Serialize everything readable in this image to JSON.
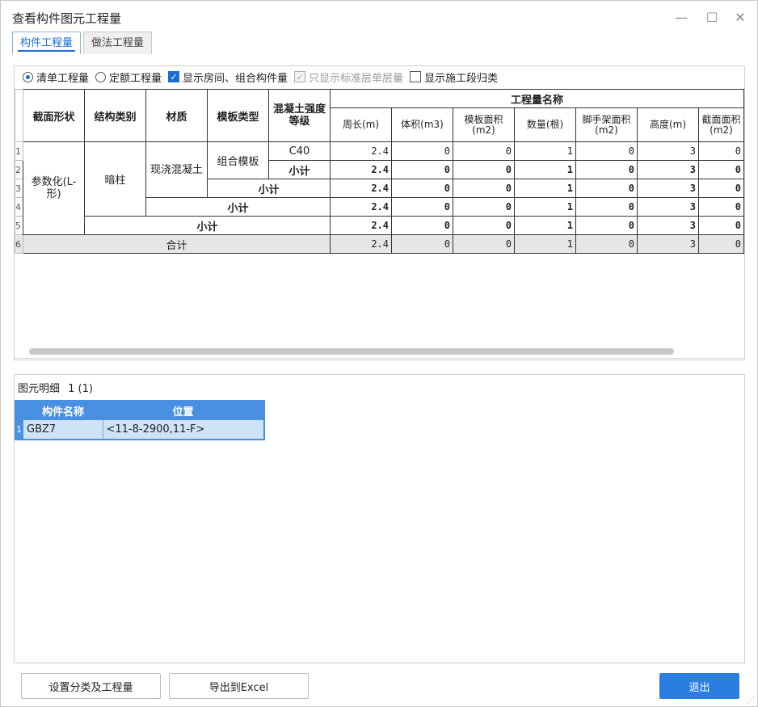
{
  "window": {
    "title": "查看构件图元工程量",
    "minimize_glyph": "—",
    "maximize_glyph": "☐",
    "close_glyph": "✕"
  },
  "tabs": [
    {
      "label": "构件工程量",
      "active": true
    },
    {
      "label": "做法工程量",
      "active": false
    }
  ],
  "options": {
    "qingdan": "清单工程量",
    "dinge": "定额工程量",
    "show_room": "显示房间、组合构件量",
    "std_floor": "只显示标准层单层量",
    "show_stage": "显示施工段归类"
  },
  "table": {
    "headers": {
      "section_shape": "截面形状",
      "struct_type": "结构类别",
      "material": "材质",
      "formwork_type": "模板类型",
      "concrete_grade": "混凝土强度等级",
      "quantity_name": "工程量名称",
      "cols": [
        "周长(m)",
        "体积(m3)",
        "模板面积(m2)",
        "数量(根)",
        "脚手架面积(m2)",
        "高度(m)",
        "截面面积(m2)"
      ]
    },
    "row_numbers": [
      "1",
      "2",
      "3",
      "4",
      "5",
      "6"
    ],
    "cells": {
      "shape": "参数化(L-形)",
      "struct": "暗柱",
      "material": "现浇混凝土",
      "formwork": "组合模板",
      "grade": "C40",
      "subtotal": "小计",
      "total": "合计"
    },
    "rows": [
      [
        "2.4",
        "0",
        "0",
        "1",
        "0",
        "3",
        "0"
      ],
      [
        "2.4",
        "0",
        "0",
        "1",
        "0",
        "3",
        "0"
      ],
      [
        "2.4",
        "0",
        "0",
        "1",
        "0",
        "3",
        "0"
      ],
      [
        "2.4",
        "0",
        "0",
        "1",
        "0",
        "3",
        "0"
      ],
      [
        "2.4",
        "0",
        "0",
        "1",
        "0",
        "3",
        "0"
      ],
      [
        "2.4",
        "0",
        "0",
        "1",
        "0",
        "3",
        "0"
      ]
    ]
  },
  "detail": {
    "title": "图元明细",
    "count": "1 (1)",
    "headers": [
      "构件名称",
      "位置"
    ],
    "rows": [
      {
        "num": "1",
        "name": "GBZ7",
        "position": "<11-8-2900,11-F>"
      }
    ]
  },
  "buttons": {
    "set_category": "设置分类及工程量",
    "export_excel": "导出到Excel",
    "exit": "退出"
  },
  "colors": {
    "accent": "#2a7de1",
    "header_blue": "#4a90e2"
  }
}
